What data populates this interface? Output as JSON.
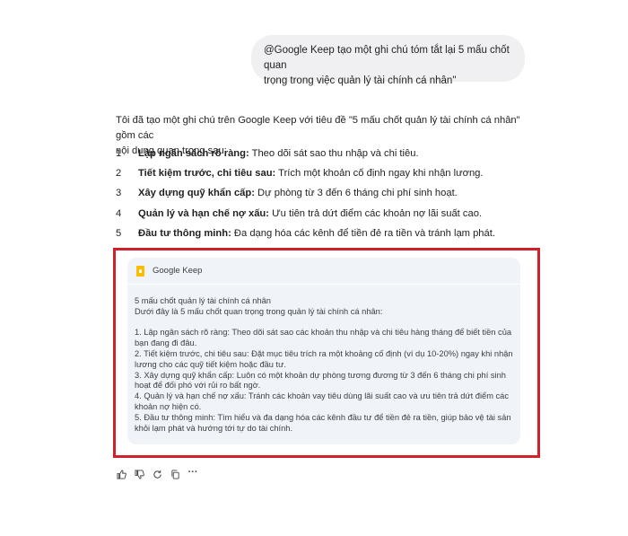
{
  "user_prompt": {
    "line1": "@Google Keep tạo một ghi chú tóm tắt lại 5 mấu chốt quan",
    "line2": "trọng trong việc quản lý tài chính cá nhân\""
  },
  "reply": {
    "intro_line1": "Tôi đã tạo một ghi chú trên Google Keep với tiêu đề \"5 mấu chốt quản lý tài chính cá nhân\" gồm các",
    "intro_line2": "nội dung quan trọng sau:",
    "steps": [
      {
        "num": "1",
        "title": "Lập ngân sách rõ ràng:",
        "desc": " Theo dõi sát sao thu nhập và chi tiêu."
      },
      {
        "num": "2",
        "title": "Tiết kiệm trước, chi tiêu sau:",
        "desc": " Trích một khoản cố định ngay khi nhận lương."
      },
      {
        "num": "3",
        "title": "Xây dựng quỹ khẩn cấp:",
        "desc": " Dự phòng từ 3 đến 6 tháng chi phí sinh hoạt."
      },
      {
        "num": "4",
        "title": "Quản lý và hạn chế nợ xấu:",
        "desc": " Ưu tiên trả dứt điểm các khoản nợ lãi suất cao."
      },
      {
        "num": "5",
        "title": "Đầu tư thông minh:",
        "desc": " Đa dạng hóa các kênh để tiền đẻ ra tiền và tránh lạm phát."
      }
    ]
  },
  "keep_card": {
    "app_name": "Google Keep",
    "note_title": "5 mấu chốt quản lý tài chính cá nhân",
    "note_subtitle": "Dưới đây là 5 mấu chốt quan trọng trong quản lý tài chính cá nhân:",
    "items": [
      {
        "line1": "1.  Lập ngân sách rõ ràng: Theo dõi sát sao các khoản thu nhập và chi tiêu hàng tháng để biết tiền của",
        "line2": "bạn đang đi đâu."
      },
      {
        "line1": "2.  Tiết kiệm trước, chi tiêu sau: Đặt mục tiêu trích ra một khoảng cố định (ví dụ 10-20%) ngay khi nhận",
        "line2": "lương cho các quỹ tiết kiệm hoặc đầu tư."
      },
      {
        "line1": "3.  Xây dựng quỹ khẩn cấp: Luôn có một khoản dự phòng tương đương từ 3 đến 6 tháng chi phí sinh",
        "line2": "hoạt để đối phó với rủi ro bất ngờ."
      },
      {
        "line1": "4.  Quản lý và hạn chế nợ xấu: Tránh các khoản vay tiêu dùng lãi suất cao và ưu tiên trả dứt điểm các",
        "line2": "khoản nợ hiện có."
      },
      {
        "line1": "5.  Đầu tư thông minh: Tìm hiểu và đa dạng hóa các kênh đầu tư để tiền đẻ ra tiền, giúp bảo vệ tài sản",
        "line2": "khỏi lạm phát và hướng tới tự do tài chính."
      }
    ]
  },
  "actions": {
    "icons": [
      "thumbs-up-icon",
      "thumbs-down-icon",
      "regenerate-icon",
      "copy-icon",
      "more-options-icon"
    ],
    "more_label": "···"
  },
  "colors": {
    "highlight": "#d0202a",
    "card_bg": "#f0f4f9",
    "bubble_bg": "#f0f0f2",
    "keep_yellow": "#fbbc04"
  }
}
